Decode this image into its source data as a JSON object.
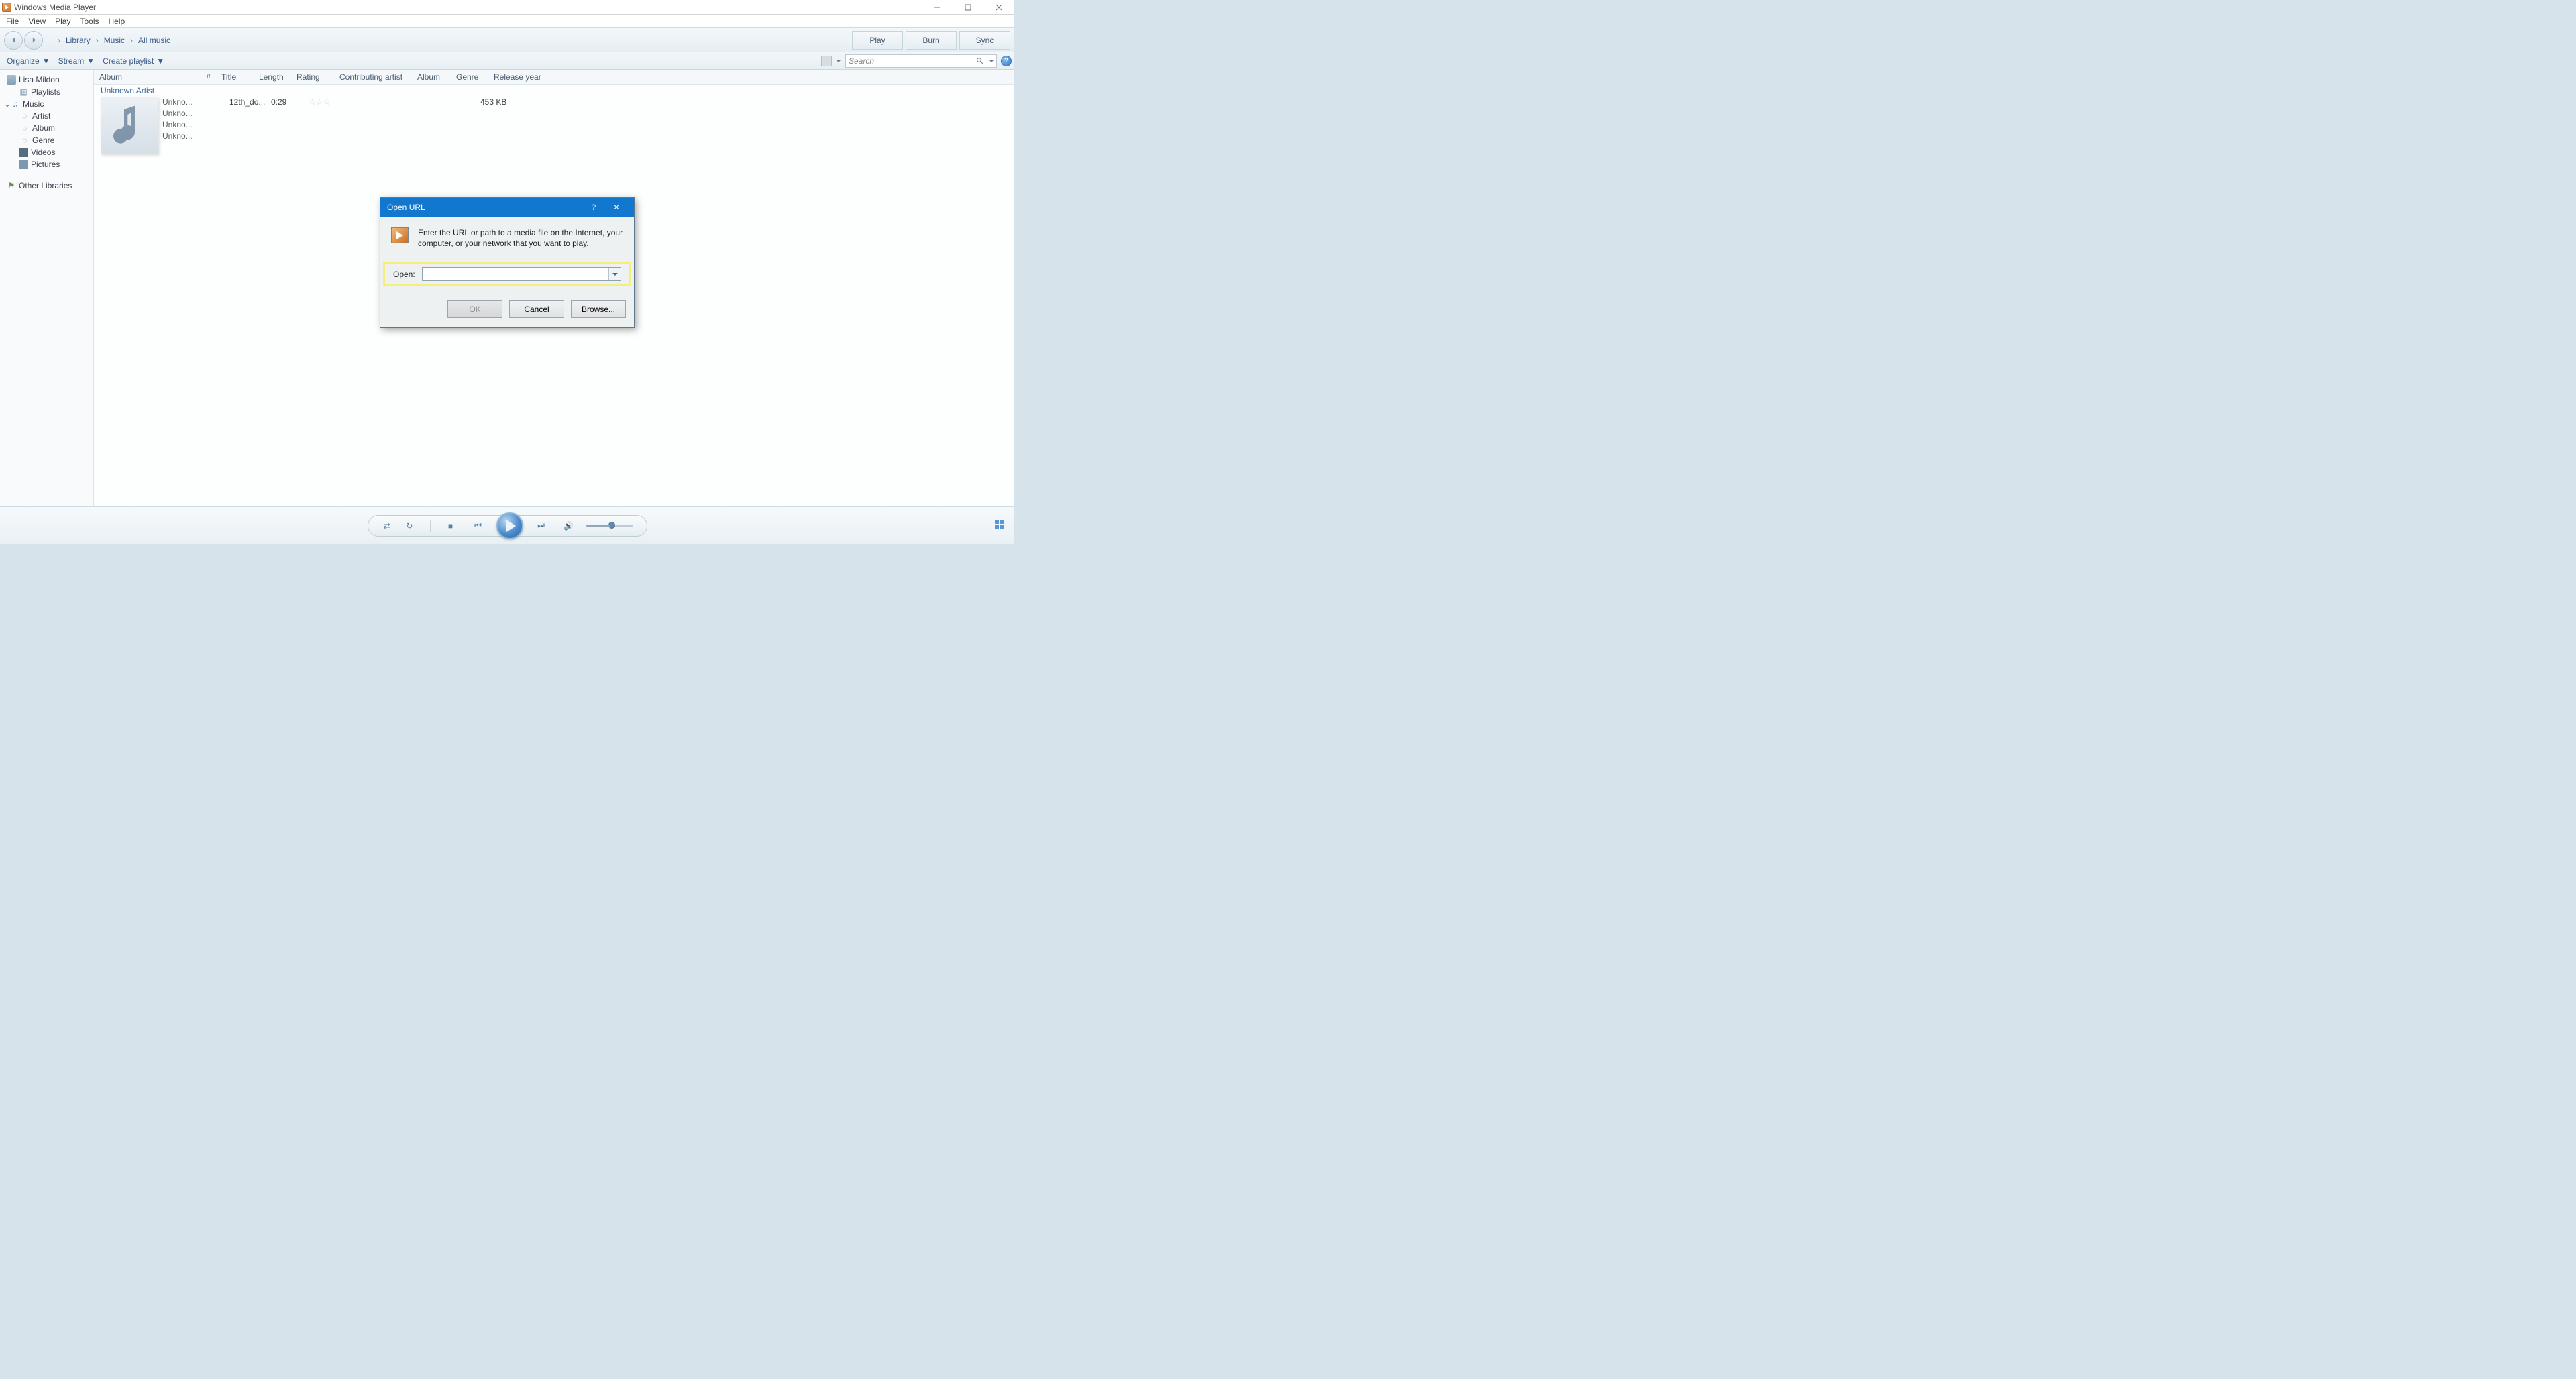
{
  "titlebar": {
    "title": "Windows Media Player"
  },
  "menu": {
    "items": [
      "File",
      "View",
      "Play",
      "Tools",
      "Help"
    ]
  },
  "breadcrumbs": {
    "items": [
      "Library",
      "Music",
      "All music"
    ]
  },
  "right_tabs": {
    "items": [
      "Play",
      "Burn",
      "Sync"
    ]
  },
  "toolbar": {
    "organize": "Organize",
    "stream": "Stream",
    "create_playlist": "Create playlist",
    "search_placeholder": "Search"
  },
  "tree": {
    "user": "Lisa Mildon",
    "playlists": "Playlists",
    "music": "Music",
    "artist": "Artist",
    "album": "Album",
    "genre": "Genre",
    "videos": "Videos",
    "pictures": "Pictures",
    "other_libraries": "Other Libraries"
  },
  "columns": {
    "album": "Album",
    "num": "#",
    "title": "Title",
    "length": "Length",
    "rating": "Rating",
    "contrib": "Contributing artist",
    "album2": "Album",
    "genre": "Genre",
    "year": "Release year"
  },
  "album": {
    "artist_heading": "Unknown Artist",
    "lines": [
      "Unkno...",
      "Unkno...",
      "Unkno...",
      "Unkno..."
    ],
    "track_title": "12th_do...",
    "track_len": "0:29",
    "track_size": "453 KB"
  },
  "dialog": {
    "title": "Open URL",
    "help": "?",
    "desc": "Enter the URL or path to a media file on the Internet, your computer, or your network that you want to play.",
    "open_label": "Open:",
    "ok": "OK",
    "cancel": "Cancel",
    "browse": "Browse..."
  }
}
